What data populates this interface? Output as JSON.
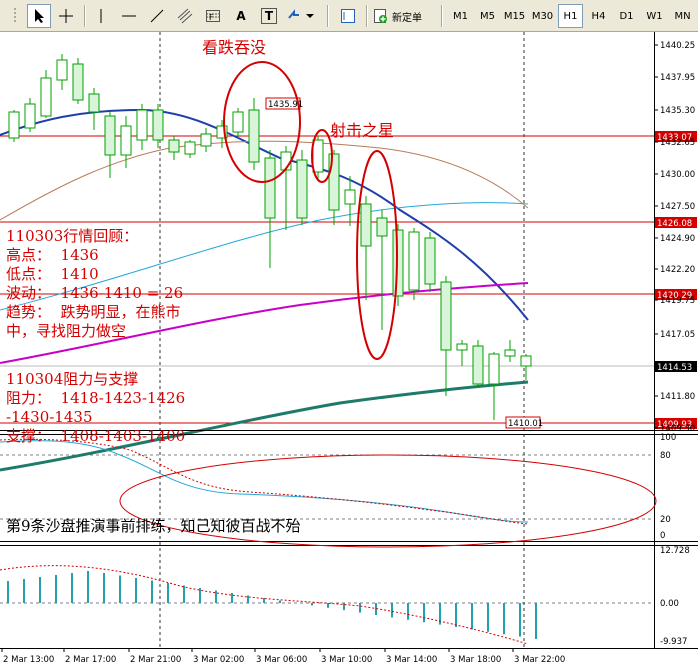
{
  "toolbar": {
    "tools": [
      {
        "icon": "cursor-arrow-icon"
      },
      {
        "icon": "crosshair-icon"
      },
      {
        "icon": "vertical-line-icon"
      },
      {
        "icon": "horizontal-line-icon"
      },
      {
        "icon": "trendline-icon"
      },
      {
        "icon": "equidistant-channel-icon"
      },
      {
        "icon": "fibonacci-icon"
      },
      {
        "icon": "text-tool-icon",
        "glyph": "A"
      },
      {
        "icon": "text-label-icon",
        "glyph": "T"
      },
      {
        "icon": "arrow-shapes-icon"
      }
    ],
    "periodicity_icon": "periodicity-icon",
    "new_order_icon": "new-order-icon",
    "new_order_label": "新定单",
    "timeframes": [
      "M1",
      "M5",
      "M15",
      "M30",
      "H1",
      "H4",
      "D1",
      "W1",
      "MN"
    ],
    "active_timeframe": "H1"
  },
  "chart": {
    "bull_color": "#ffffff",
    "bear_color": "#d9f5d9",
    "candle_outline": "#00a000",
    "ma_colors": [
      "#1f3fa8",
      "#b87b58",
      "#22a8d8",
      "#c800c8",
      "#1e7a6a"
    ],
    "hline_color": "#d40000",
    "price_axis_ticks": [
      "1440.25",
      "1437.95",
      "1435.30",
      "1432.65",
      "1430.00",
      "1427.50",
      "1424.90",
      "1422.20",
      "1419.75",
      "1417.05",
      "1411.80",
      "1409.30"
    ],
    "level_labels": [
      "1433.07",
      "1426.08",
      "1420.29",
      "1409.93"
    ],
    "current_price": "1414.53",
    "chart_labels": [
      "1435.91",
      "1410.01"
    ],
    "stoch_axis": [
      "100",
      "80",
      "20",
      "0"
    ],
    "macd_axis": [
      "12.728",
      "0.00",
      "-9.937"
    ],
    "time_axis": [
      "2 Mar 13:00",
      "2 Mar 17:00",
      "2 Mar 21:00",
      "3 Mar 02:00",
      "3 Mar 06:00",
      "3 Mar 10:00",
      "3 Mar 14:00",
      "3 Mar 18:00",
      "3 Mar 22:00"
    ]
  },
  "annotations": {
    "engulf_label": "看跌吞没",
    "shooting_star": "射击之星",
    "review_title": "110303行情回顾：",
    "high": "高点：  1436",
    "low": "低点：  1410",
    "range": "波动：  1436-1410 = 26",
    "trend1": "趋势：  跌势明显，在熊市",
    "trend2": "中，寻找阻力做空",
    "sr_title": "110304阻力与支撑",
    "resistance": "阻力：  1418-1423-1426",
    "resistance2": "-1430-1435",
    "support": "支撑：  1408-1403-1400",
    "rule": "第9条沙盘推演事前排练，知己知彼百战不殆"
  }
}
